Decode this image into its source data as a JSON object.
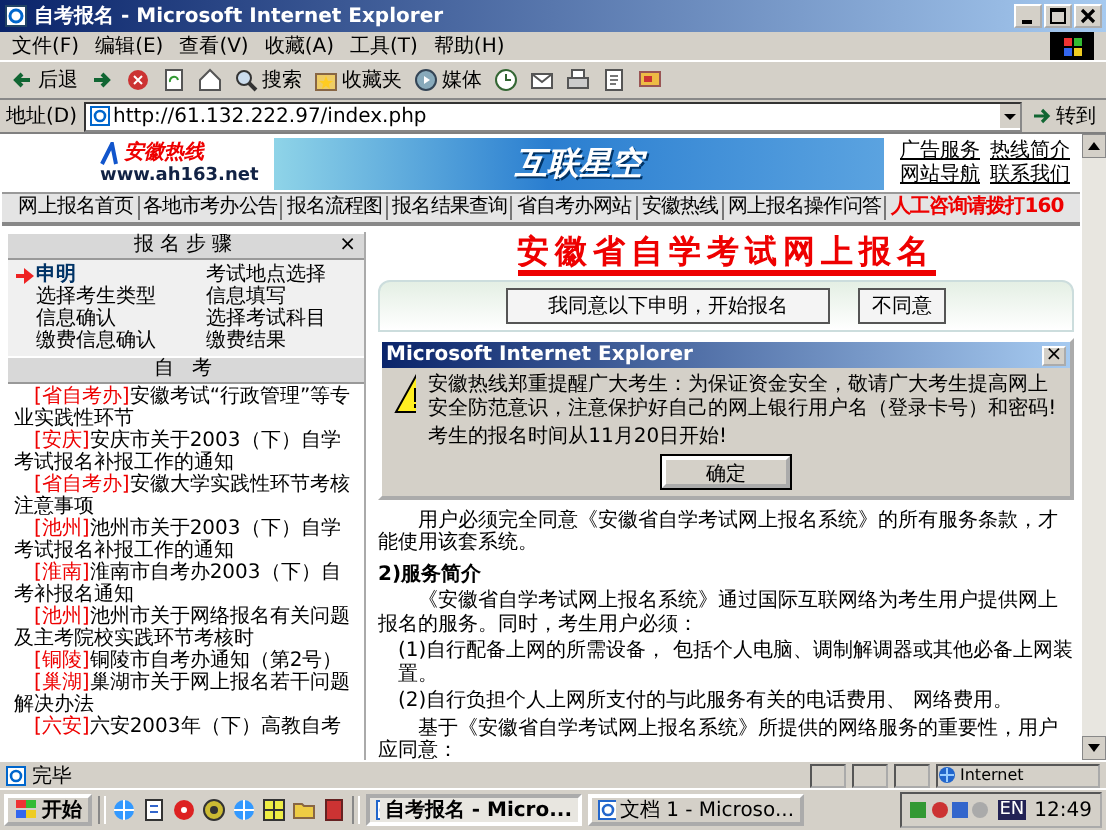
{
  "window": {
    "title": "自考报名 - Microsoft Internet Explorer"
  },
  "menu": [
    "文件(F)",
    "编辑(E)",
    "查看(V)",
    "收藏(A)",
    "工具(T)",
    "帮助(H)"
  ],
  "toolbar": [
    {
      "kind": "back",
      "label": "后退"
    },
    {
      "kind": "forward"
    },
    {
      "kind": "stop"
    },
    {
      "kind": "refresh"
    },
    {
      "kind": "home"
    },
    {
      "kind": "search",
      "label": "搜索"
    },
    {
      "kind": "favorites",
      "label": "收藏夹"
    },
    {
      "kind": "media",
      "label": "媒体"
    },
    {
      "kind": "history"
    },
    {
      "kind": "mail"
    },
    {
      "kind": "print"
    },
    {
      "kind": "edit"
    },
    {
      "kind": "discuss"
    }
  ],
  "address_bar": {
    "label": "地址(D)",
    "url": "http://61.132.222.97/index.php",
    "go": "转到"
  },
  "page": {
    "logo": {
      "name": "安徽热线",
      "url": "www.ah163.net"
    },
    "banner": {
      "text": "互联星空"
    },
    "top_links": [
      "广告服务",
      "热线简介",
      "网站导航",
      "联系我们"
    ],
    "nav": [
      {
        "kind": "link",
        "label": "网上报名首页"
      },
      {
        "kind": "link",
        "label": "各地市考办公告"
      },
      {
        "kind": "link",
        "label": "报名流程图"
      },
      {
        "kind": "link",
        "label": "报名结果查询"
      },
      {
        "kind": "link",
        "label": "省自考办网站"
      },
      {
        "kind": "link",
        "label": "安徽热线"
      },
      {
        "kind": "link",
        "label": "网上报名操作问答"
      },
      {
        "kind": "hotline",
        "label": "人工咨询请拨打160"
      }
    ],
    "steps_panel": {
      "title": "报名步骤",
      "close": "×",
      "items": [
        {
          "label": "申明",
          "selected": true
        },
        {
          "label": "考试地点选择",
          "selected": false
        },
        {
          "label": "选择考生类型",
          "selected": false
        },
        {
          "label": "信息填写",
          "selected": false
        },
        {
          "label": "信息确认",
          "selected": false
        },
        {
          "label": "选择考试科目",
          "selected": false
        },
        {
          "label": "缴费信息确认",
          "selected": false
        },
        {
          "label": "缴费结果",
          "selected": false
        }
      ]
    },
    "news_panel": {
      "title": "自 考",
      "items": [
        {
          "tag": "[省自考办]",
          "text": "安徽考试“行政管理”等专业实践性环节"
        },
        {
          "tag": "[安庆]",
          "text": "安庆市关于2003（下）自学考试报名补报工作的通知"
        },
        {
          "tag": "[省自考办]",
          "text": "安徽大学实践性环节考核注意事项"
        },
        {
          "tag": "[池州]",
          "text": "池州市关于2003（下）自学考试报名补报工作的通知"
        },
        {
          "tag": "[淮南]",
          "text": "淮南市自考办2003（下）自考补报名通知"
        },
        {
          "tag": "[池州]",
          "text": "池州市关于网络报名有关问题及主考院校实践环节考核时"
        },
        {
          "tag": "[铜陵]",
          "text": "铜陵市自考办通知（第2号）"
        },
        {
          "tag": "[巢湖]",
          "text": "巢湖市关于网上报名若干问题解决办法"
        },
        {
          "tag": "[六安]",
          "text": "六安2003年（下）高教自考"
        }
      ]
    },
    "main": {
      "title": "安徽省自学考试网上报名",
      "buttons": [
        "我同意以下申明，开始报名",
        "不同意"
      ],
      "sections": [
        {
          "kind": "paragraph",
          "text": "用户必须完全同意《安徽省自学考试网上报名系统》的所有服务条款，才能使用该套系统。"
        },
        {
          "kind": "heading",
          "text": "2)服务简介"
        },
        {
          "kind": "paragraph",
          "text": "《安徽省自学考试网上报名系统》通过国际互联网络为考生用户提供网上报名的服务。同时，考生用户必须："
        },
        {
          "kind": "list_item",
          "text": "(1)自行配备上网的所需设备， 包括个人电脑、调制解调器或其他必备上网装置。"
        },
        {
          "kind": "list_item",
          "text": "(2)自行负担个人上网所支付的与此服务有关的电话费用、 网络费用。"
        },
        {
          "kind": "paragraph",
          "text": "基于《安徽省自学考试网上报名系统》所提供的网络服务的重要性，用户应同意："
        }
      ]
    }
  },
  "dialog": {
    "title": "Microsoft Internet Explorer",
    "close": "×",
    "messages": [
      "安徽热线郑重提醒广大考生：为保证资金安全，敬请广大考生提高网上安全防范意识，注意保护好自己的网上银行用户名（登录卡号）和密码!",
      "考生的报名时间从11月20日开始!"
    ],
    "button": "确定"
  },
  "status_bar": {
    "text": "完毕",
    "zone": "Internet"
  },
  "taskbar": {
    "start": "开始",
    "quick_launch": [
      {
        "kind": "globe"
      },
      {
        "kind": "notepad"
      },
      {
        "kind": "disc"
      },
      {
        "kind": "gear"
      },
      {
        "kind": "globe"
      },
      {
        "kind": "grid"
      },
      {
        "kind": "folder"
      },
      {
        "kind": "book"
      }
    ],
    "tasks": [
      {
        "label": "自考报名 - Micro...",
        "selected": true
      },
      {
        "label": "文档 1 - Microso...",
        "selected": false
      }
    ],
    "language": "EN",
    "clock": "12:49"
  }
}
